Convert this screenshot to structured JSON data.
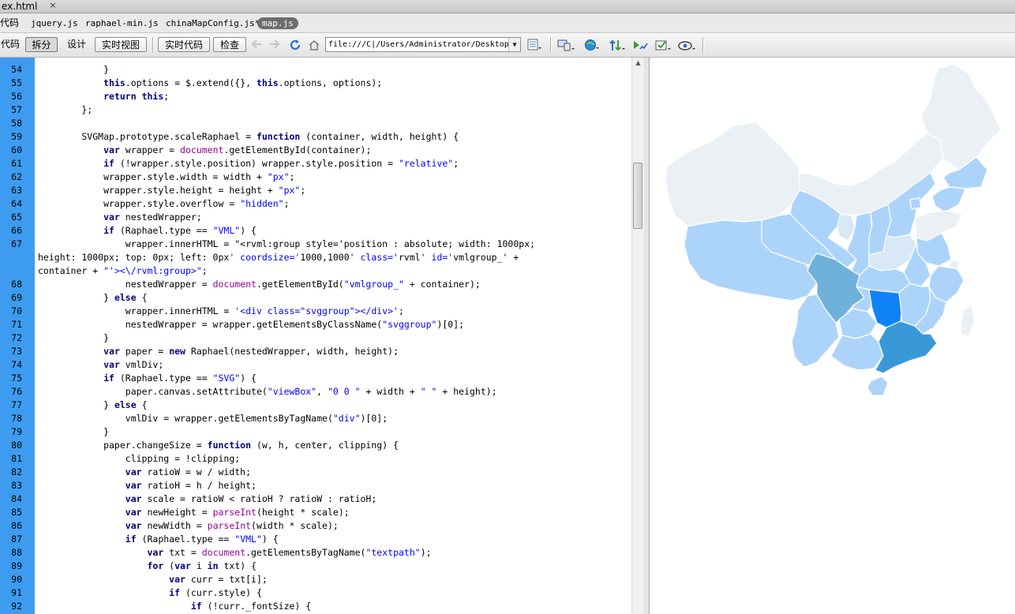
{
  "window": {
    "title": "ex.html",
    "close_glyph": "×"
  },
  "file_tabs": [
    {
      "label": "代码"
    },
    {
      "label": "jquery.js"
    },
    {
      "label": "raphael-min.js"
    },
    {
      "label": "chinaMapConfig.js*"
    },
    {
      "label": "map.js"
    }
  ],
  "toolbar": {
    "code_label": "代码",
    "split_label": "拆分",
    "design_label": "设计",
    "live_view_label": "实时视图",
    "live_code_label": "实时代码",
    "inspect_label": "检查",
    "url": "file:///C|/Users/Administrator/Desktop"
  },
  "icons": {
    "back": "back-arrow-icon",
    "forward": "forward-arrow-icon",
    "refresh": "refresh-icon",
    "home": "home-icon",
    "options": "view-options-icon",
    "multiscreen": "multiscreen-icon",
    "browser": "preview-in-browser-icon",
    "file_mgmt": "file-management-icon",
    "validate": "validate-markup-icon",
    "check_page": "check-page-icon",
    "visual_aids": "visual-aids-icon"
  },
  "colors": {
    "gutter": "#3d9cf0",
    "keyword": "#000080",
    "string": "#0000ff",
    "builtin": "#990099",
    "map_highlight": "#0f82f5",
    "map_dark": "#3999d8"
  },
  "code_lines": [
    {
      "num": "54",
      "text": "            }"
    },
    {
      "num": "55",
      "text": "            this.options = $.extend({}, this.options, options);"
    },
    {
      "num": "56",
      "text": "            return this;"
    },
    {
      "num": "57",
      "text": "        };"
    },
    {
      "num": "58",
      "text": ""
    },
    {
      "num": "59",
      "text": "        SVGMap.prototype.scaleRaphael = function (container, width, height) {"
    },
    {
      "num": "60",
      "text": "            var wrapper = document.getElementById(container);"
    },
    {
      "num": "61",
      "text": "            if (!wrapper.style.position) wrapper.style.position = \"relative\";"
    },
    {
      "num": "62",
      "text": "            wrapper.style.width = width + \"px\";"
    },
    {
      "num": "63",
      "text": "            wrapper.style.height = height + \"px\";"
    },
    {
      "num": "64",
      "text": "            wrapper.style.overflow = \"hidden\";"
    },
    {
      "num": "65",
      "text": "            var nestedWrapper;"
    },
    {
      "num": "66",
      "text": "            if (Raphael.type == \"VML\") {"
    },
    {
      "num": "67",
      "text": "                wrapper.innerHTML = \"<rvml:group style='position : absolute; width: 1000px;"
    },
    {
      "num": "",
      "text": "height: 1000px; top: 0px; left: 0px' coordsize='1000,1000' class='rvml' id='vmlgroup_' +"
    },
    {
      "num": "",
      "text": "container + \"'><\\/rvml:group>\";"
    },
    {
      "num": "68",
      "text": "                nestedWrapper = document.getElementById(\"vmlgroup_\" + container);"
    },
    {
      "num": "69",
      "text": "            } else {"
    },
    {
      "num": "70",
      "text": "                wrapper.innerHTML = '<div class=\"svggroup\"></div>';"
    },
    {
      "num": "71",
      "text": "                nestedWrapper = wrapper.getElementsByClassName(\"svggroup\")[0];"
    },
    {
      "num": "72",
      "text": "            }"
    },
    {
      "num": "73",
      "text": "            var paper = new Raphael(nestedWrapper, width, height);"
    },
    {
      "num": "74",
      "text": "            var vmlDiv;"
    },
    {
      "num": "75",
      "text": "            if (Raphael.type == \"SVG\") {"
    },
    {
      "num": "76",
      "text": "                paper.canvas.setAttribute(\"viewBox\", \"0 0 \" + width + \" \" + height);"
    },
    {
      "num": "77",
      "text": "            } else {"
    },
    {
      "num": "78",
      "text": "                vmlDiv = wrapper.getElementsByTagName(\"div\")[0];"
    },
    {
      "num": "79",
      "text": "            }"
    },
    {
      "num": "80",
      "text": "            paper.changeSize = function (w, h, center, clipping) {"
    },
    {
      "num": "81",
      "text": "                clipping = !clipping;"
    },
    {
      "num": "82",
      "text": "                var ratioW = w / width;"
    },
    {
      "num": "83",
      "text": "                var ratioH = h / height;"
    },
    {
      "num": "84",
      "text": "                var scale = ratioW < ratioH ? ratioW : ratioH;"
    },
    {
      "num": "85",
      "text": "                var newHeight = parseInt(height * scale);"
    },
    {
      "num": "86",
      "text": "                var newWidth = parseInt(width * scale);"
    },
    {
      "num": "87",
      "text": "                if (Raphael.type == \"VML\") {"
    },
    {
      "num": "88",
      "text": "                    var txt = document.getElementsByTagName(\"textpath\");"
    },
    {
      "num": "89",
      "text": "                    for (var i in txt) {"
    },
    {
      "num": "90",
      "text": "                        var curr = txt[i];"
    },
    {
      "num": "91",
      "text": "                        if (curr.style) {"
    },
    {
      "num": "92",
      "text": "                            if (!curr._fontSize) {"
    }
  ]
}
